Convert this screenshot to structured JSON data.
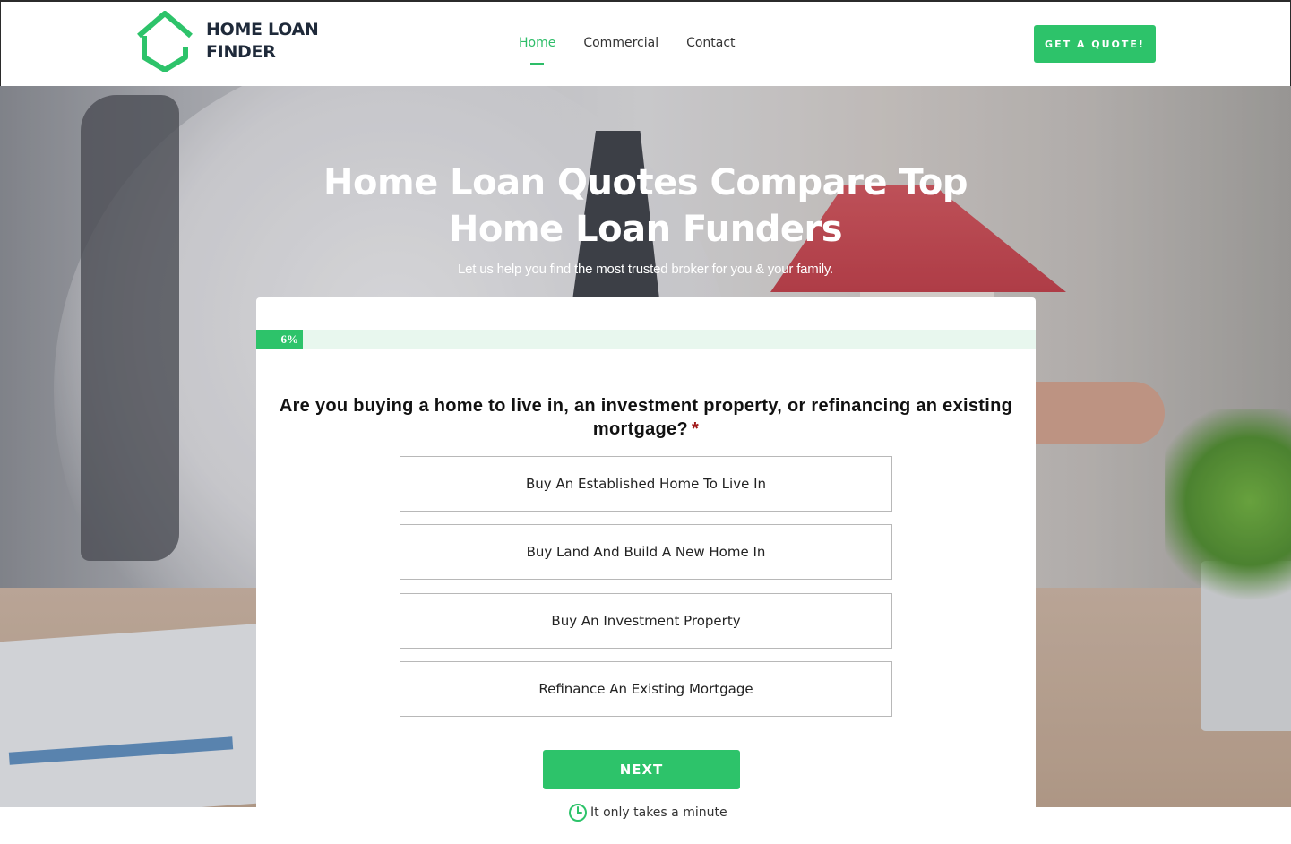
{
  "header": {
    "logo_line1": "HOME LOAN",
    "logo_line2": "FINDER",
    "nav": [
      {
        "label": "Home",
        "active": true
      },
      {
        "label": "Commercial",
        "active": false
      },
      {
        "label": "Contact",
        "active": false
      }
    ],
    "cta_label": "GET A QUOTE!"
  },
  "hero": {
    "title": "Home Loan Quotes Compare Top Home Loan Funders",
    "subtitle": "Let us help you find the most trusted broker for you & your family."
  },
  "form": {
    "progress_label": "6%",
    "progress_value": 6,
    "question": "Are you buying a home to live in, an investment property, or refinancing an existing mortgage?",
    "required_mark": "*",
    "options": [
      "Buy An Established Home To Live In",
      "Buy Land And Build A New Home In",
      "Buy An Investment Property",
      "Refinance An Existing Mortgage"
    ],
    "next_label": "NEXT",
    "note": "It only takes a minute"
  },
  "colors": {
    "accent": "#2dc36a",
    "brand_dark": "#1f2a3a",
    "required": "#a01818"
  },
  "icons": [
    "house-logo-icon",
    "clock-icon"
  ]
}
